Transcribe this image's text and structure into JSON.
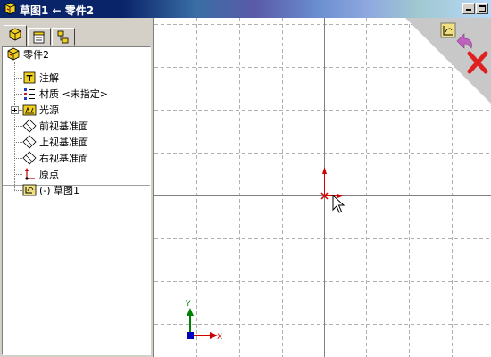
{
  "window": {
    "title": "草图1 ← 零件2",
    "icons": {
      "app": "solidworks-part-icon",
      "minimize": "minimize-icon",
      "maximize": "maximize-icon"
    }
  },
  "panel": {
    "tabs": [
      {
        "name": "feature-manager-tab",
        "icon": "feature-tree-icon",
        "active": true
      },
      {
        "name": "property-manager-tab",
        "icon": "property-icon",
        "active": false
      },
      {
        "name": "configuration-manager-tab",
        "icon": "configuration-icon",
        "active": false
      }
    ],
    "tree": {
      "root": {
        "label": "零件2",
        "icon": "part-icon"
      },
      "items": [
        {
          "label": "注解",
          "icon": "annotations-icon"
        },
        {
          "label": "材质 <未指定>",
          "icon": "material-icon"
        },
        {
          "label": "光源",
          "icon": "lights-icon",
          "expandable": true
        },
        {
          "label": "前视基准面",
          "icon": "plane-icon"
        },
        {
          "label": "上视基准面",
          "icon": "plane-icon"
        },
        {
          "label": "右视基准面",
          "icon": "plane-icon"
        },
        {
          "label": "原点",
          "icon": "origin-icon"
        }
      ],
      "sketch": {
        "label": "(-) 草图1",
        "icon": "sketch-icon"
      }
    }
  },
  "canvas": {
    "axis_labels": {
      "x": "X",
      "y": "Y"
    },
    "corner_icons": [
      "exit-sketch-icon",
      "rebuild-icon",
      "cancel-sketch-icon"
    ],
    "colors": {
      "grid": "#b0b0b0",
      "origin": "#d00000",
      "triad_y": "#008000",
      "triad_x": "#d00000",
      "triad_z": "#0000c0"
    }
  }
}
